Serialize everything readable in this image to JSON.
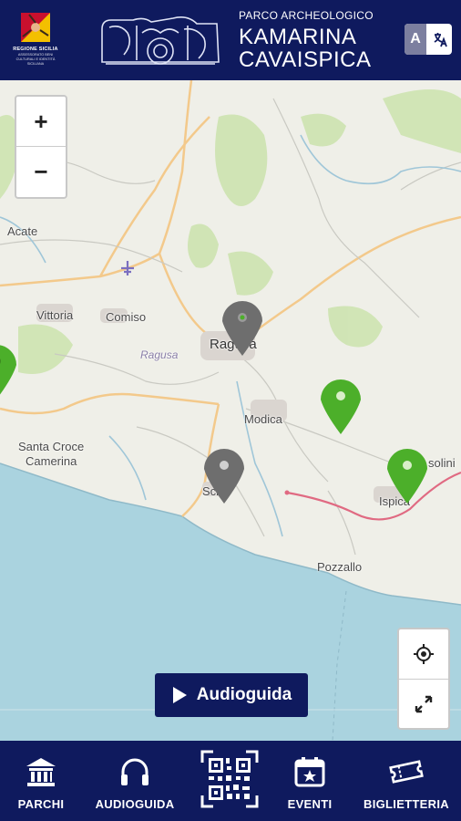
{
  "header": {
    "region_name": "REGIONE SICILIA",
    "region_sub": "ASSESSORATO BENI CULTURALI E IDENTITÀ SICILIANA",
    "park_title_small": "PARCO ARCHEOLOGICO",
    "park_title_line1": "KAMARINA",
    "park_title_line2": "CAVAISPICA",
    "lang_button_letter": "A",
    "lang_icon": "translate-icon"
  },
  "map": {
    "zoom_in_label": "+",
    "zoom_out_label": "−",
    "labels": {
      "acate": "Acate",
      "vittoria": "Vittoria",
      "comiso": "Comiso",
      "ragusa": "Ragusa",
      "ragusa_prov": "Ragusa",
      "modica": "Modica",
      "santa_croce": "Santa Croce",
      "camerina": "Camerina",
      "scicli": "Scicli",
      "ispica": "Ispica",
      "pozzallo": "Pozzallo",
      "rosolini": "solini"
    },
    "audio_button_label": "Audioguida",
    "locate_icon": "locate-icon",
    "fullscreen_icon": "fullscreen-icon",
    "colors": {
      "pin_green": "#4caf2a",
      "pin_grey": "#6e6e6e",
      "sea": "#aad3df"
    }
  },
  "nav": {
    "items": [
      {
        "label": "PARCHI",
        "icon": "museum-icon"
      },
      {
        "label": "AUDIOGUIDA",
        "icon": "headphones-icon"
      },
      {
        "label": "EVENTI",
        "icon": "calendar-icon"
      },
      {
        "label": "BIGLIETTERIA",
        "icon": "ticket-icon"
      }
    ],
    "qr_icon": "qr-code-icon"
  },
  "colors": {
    "brand_navy": "#0f1a5e"
  }
}
